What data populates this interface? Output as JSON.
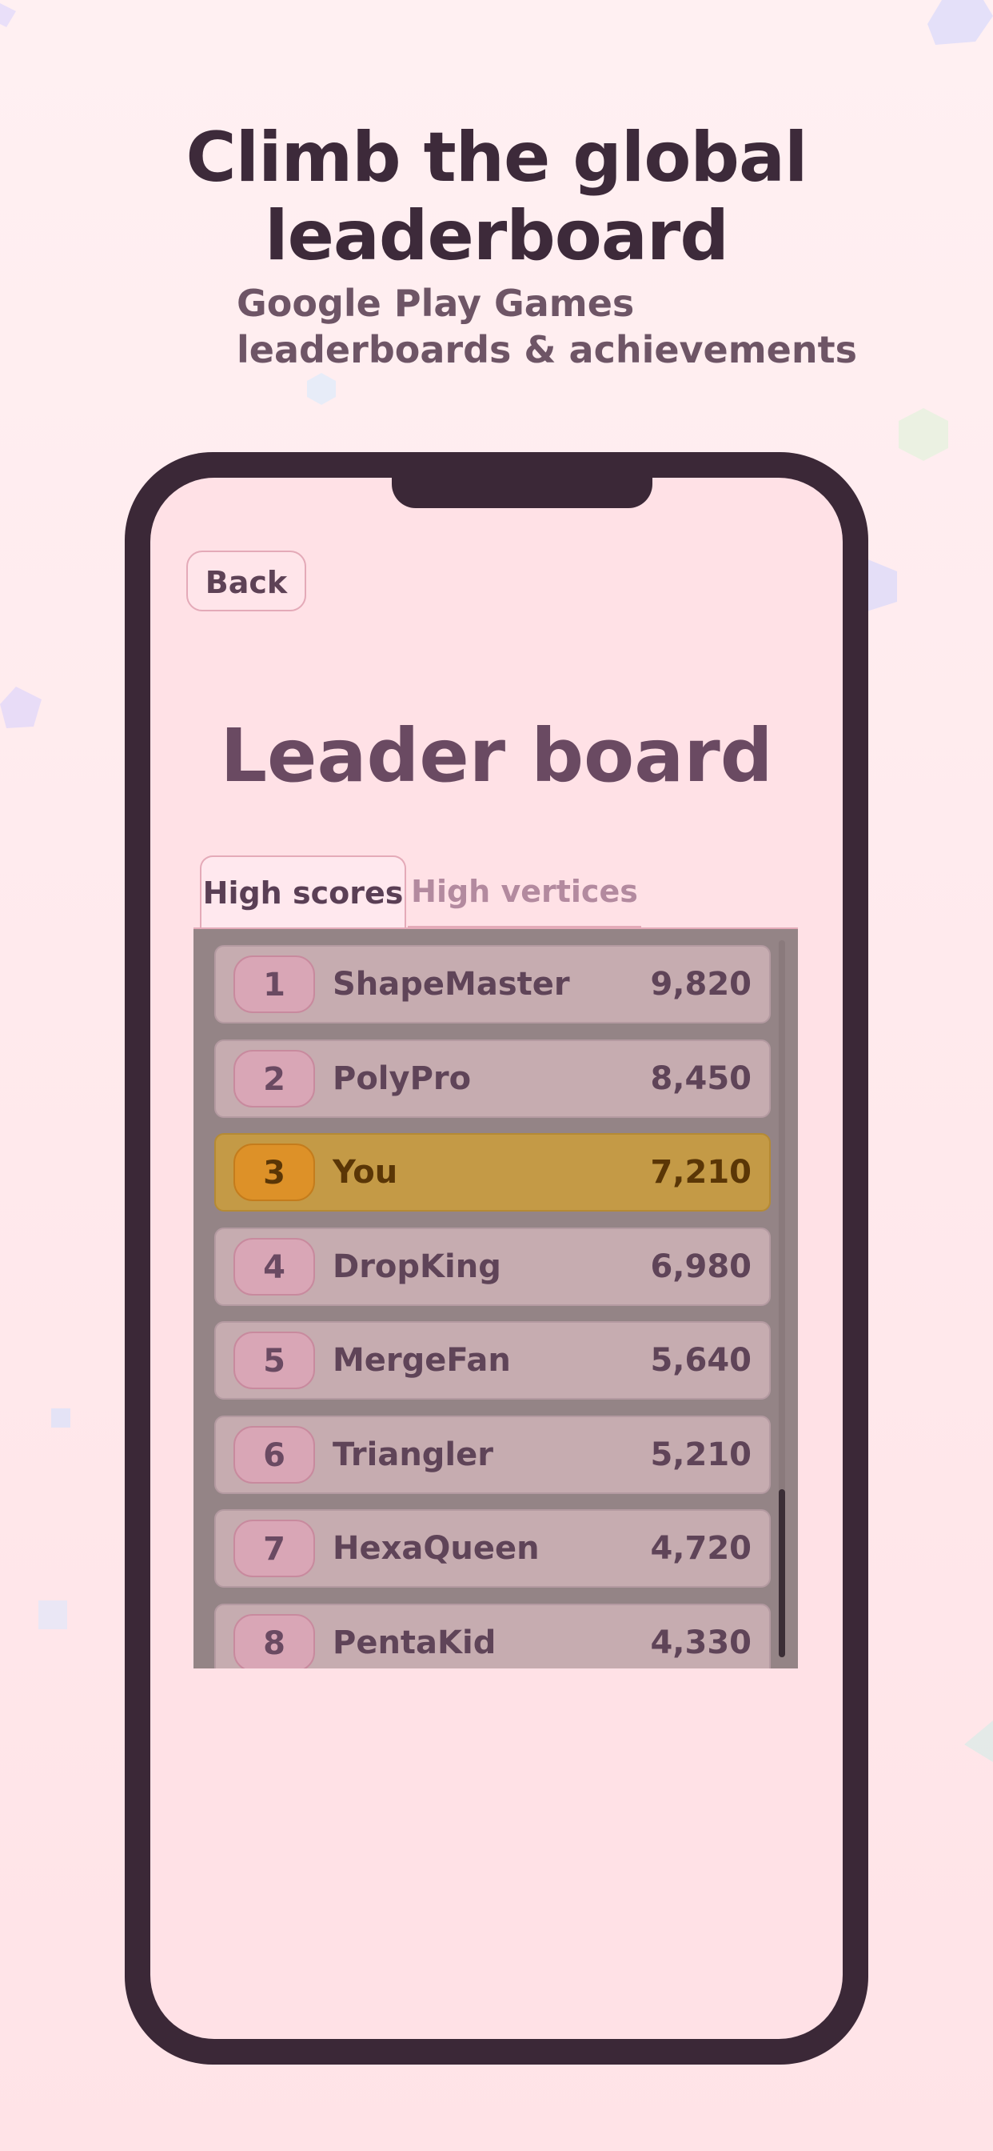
{
  "promo": {
    "headline_line1": "Climb the global",
    "headline_line2": "leaderboard",
    "subline_line1": "Google Play Games",
    "subline_line2": "leaderboards & achievements"
  },
  "screen": {
    "back_label": "Back",
    "title": "Leader board",
    "tabs": [
      {
        "label": "High scores",
        "active": true
      },
      {
        "label": "High vertices",
        "active": false
      }
    ],
    "entries": [
      {
        "rank": "1",
        "name": "ShapeMaster",
        "score": "9,820"
      },
      {
        "rank": "2",
        "name": "PolyPro",
        "score": "8,450"
      },
      {
        "rank": "3",
        "name": "You",
        "score": "7,210"
      },
      {
        "rank": "4",
        "name": "DropKing",
        "score": "6,980"
      },
      {
        "rank": "5",
        "name": "MergeFan",
        "score": "5,640"
      },
      {
        "rank": "6",
        "name": "Triangler",
        "score": "5,210"
      },
      {
        "rank": "7",
        "name": "HexaQueen",
        "score": "4,720"
      },
      {
        "rank": "8",
        "name": "PentaKid",
        "score": "4,330"
      }
    ]
  },
  "colors": {
    "background": "#ffe3e7",
    "phone_frame": "#3b2837",
    "highlight_row": "#c49a46",
    "rank_badge": "#d9a6b6"
  }
}
